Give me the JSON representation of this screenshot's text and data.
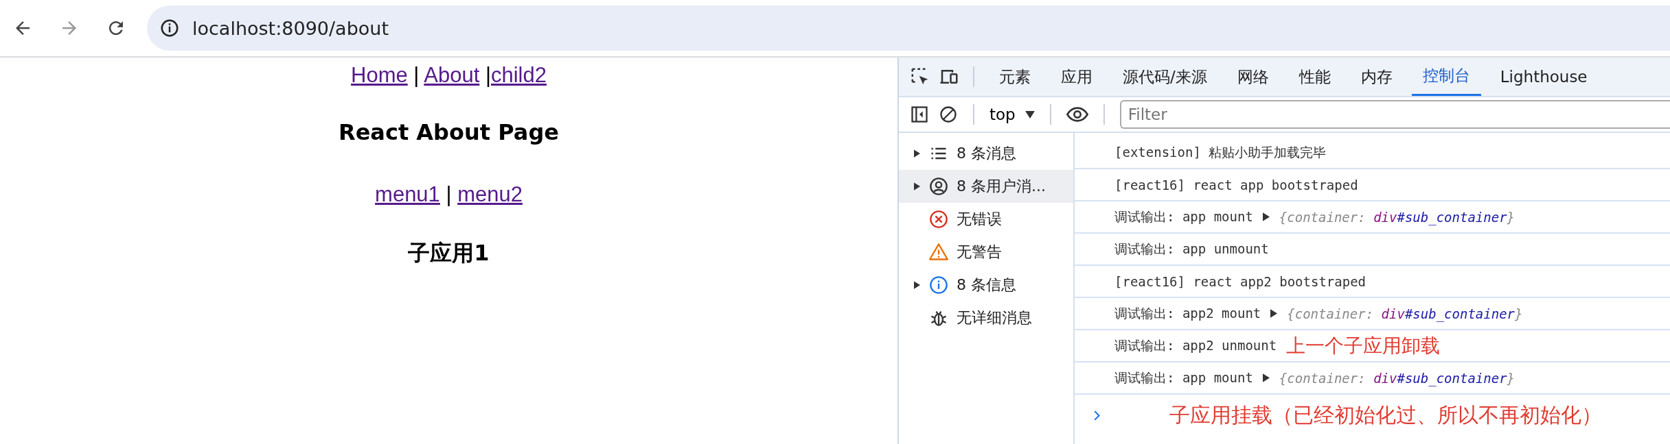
{
  "browser": {
    "address": "localhost:8090/about"
  },
  "page": {
    "nav": [
      {
        "label": "Home",
        "sep": " | "
      },
      {
        "label": "About",
        "sep": " |"
      },
      {
        "label": "child2"
      }
    ],
    "title": "React About Page",
    "menu": [
      {
        "label": "menu1",
        "sep": " | "
      },
      {
        "label": "menu2"
      }
    ],
    "subtitle": "子应用1"
  },
  "devtools": {
    "tabs": [
      {
        "label": "元素",
        "selected": false
      },
      {
        "label": "应用",
        "selected": false
      },
      {
        "label": "源代码/来源",
        "selected": false
      },
      {
        "label": "网络",
        "selected": false
      },
      {
        "label": "性能",
        "selected": false
      },
      {
        "label": "内存",
        "selected": false
      },
      {
        "label": "控制台",
        "selected": true
      },
      {
        "label": "Lighthouse",
        "selected": false
      }
    ],
    "context": "top",
    "filter": {
      "placeholder": "Filter"
    },
    "sidebar": [
      {
        "kind": "list",
        "label": "8 条消息",
        "expandable": true,
        "selected": false
      },
      {
        "kind": "user",
        "label": "8 条用户消...",
        "expandable": true,
        "selected": true
      },
      {
        "kind": "error",
        "label": "无错误",
        "expandable": false,
        "selected": false
      },
      {
        "kind": "warning",
        "label": "无警告",
        "expandable": false,
        "selected": false
      },
      {
        "kind": "info",
        "label": "8 条信息",
        "expandable": true,
        "selected": false
      },
      {
        "kind": "verbose",
        "label": "无详细消息",
        "expandable": false,
        "selected": false
      }
    ],
    "logs": [
      {
        "text": "[extension] 粘贴小助手加载完毕"
      },
      {
        "text": "[react16] react app bootstraped"
      },
      {
        "text": "调试输出: app mount",
        "preview": [
          {
            "kind": "punct",
            "text": "{container: "
          },
          {
            "kind": "tag",
            "text": "div"
          },
          {
            "kind": "id",
            "text": "#sub_container"
          },
          {
            "kind": "punct",
            "text": "}"
          }
        ]
      },
      {
        "text": "调试输出: app unmount"
      },
      {
        "text": "[react16] react app2 bootstraped"
      },
      {
        "text": "调试输出: app2 mount",
        "preview": [
          {
            "kind": "punct",
            "text": "{container: "
          },
          {
            "kind": "tag",
            "text": "div"
          },
          {
            "kind": "id",
            "text": "#sub_container"
          },
          {
            "kind": "punct",
            "text": "}"
          }
        ]
      },
      {
        "text": "调试输出: app2 unmount",
        "note": "上一个子应用卸载"
      },
      {
        "text": "调试输出: app mount",
        "preview": [
          {
            "kind": "punct",
            "text": "{container: "
          },
          {
            "kind": "tag",
            "text": "div"
          },
          {
            "kind": "id",
            "text": "#sub_container"
          },
          {
            "kind": "punct",
            "text": "}"
          }
        ]
      }
    ],
    "prompt_note": "子应用挂载（已经初始化过、所以不再初始化）"
  }
}
